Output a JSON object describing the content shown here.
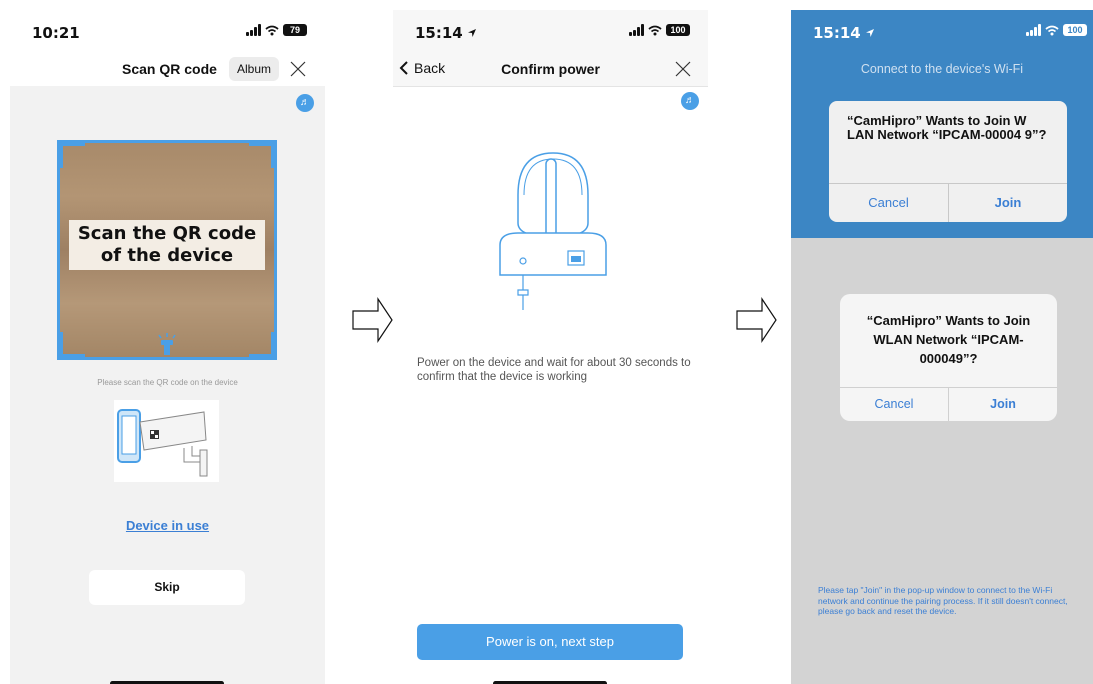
{
  "screen1": {
    "time": "10:21",
    "battery": "79",
    "title": "Scan QR code",
    "album_label": "Album",
    "overlay_line1": "Scan the QR code",
    "overlay_line2": "of the device",
    "hint": "Please scan the QR code on the device",
    "device_in_use": "Device in use",
    "skip": "Skip"
  },
  "screen2": {
    "time": "15:14",
    "battery": "100",
    "back_label": "Back",
    "title": "Confirm power",
    "instruction": "Power on the device and wait for about 30 seconds to confirm that the device is working",
    "next_button": "Power is on, next step"
  },
  "screen3": {
    "time": "15:14",
    "battery": "100",
    "header": "Connect to the device's Wi-Fi",
    "alert1_message": "“CamHipro” Wants to Join W LAN Network “IPCAM-00004 9”?",
    "alert1_cancel": "Cancel",
    "alert1_join": "Join",
    "alert2_message": "“CamHipro” Wants to Join WLAN Network “IPCAM-000049”?",
    "alert2_cancel": "Cancel",
    "alert2_join": "Join",
    "footer": "Please tap \"Join\" in the pop-up window to connect to the Wi-Fi network and continue the pairing process. If it still doesn't connect, please go back and reset the device."
  },
  "colors": {
    "accent": "#4a9fe6",
    "link": "#3b7fd4",
    "blue_header": "#3c86c4"
  },
  "icons": [
    "close-icon",
    "back-chevron-icon",
    "speaker-icon",
    "signal-icon",
    "wifi-icon",
    "battery-icon",
    "location-arrow-icon",
    "flashlight-icon",
    "right-arrow-icon"
  ]
}
